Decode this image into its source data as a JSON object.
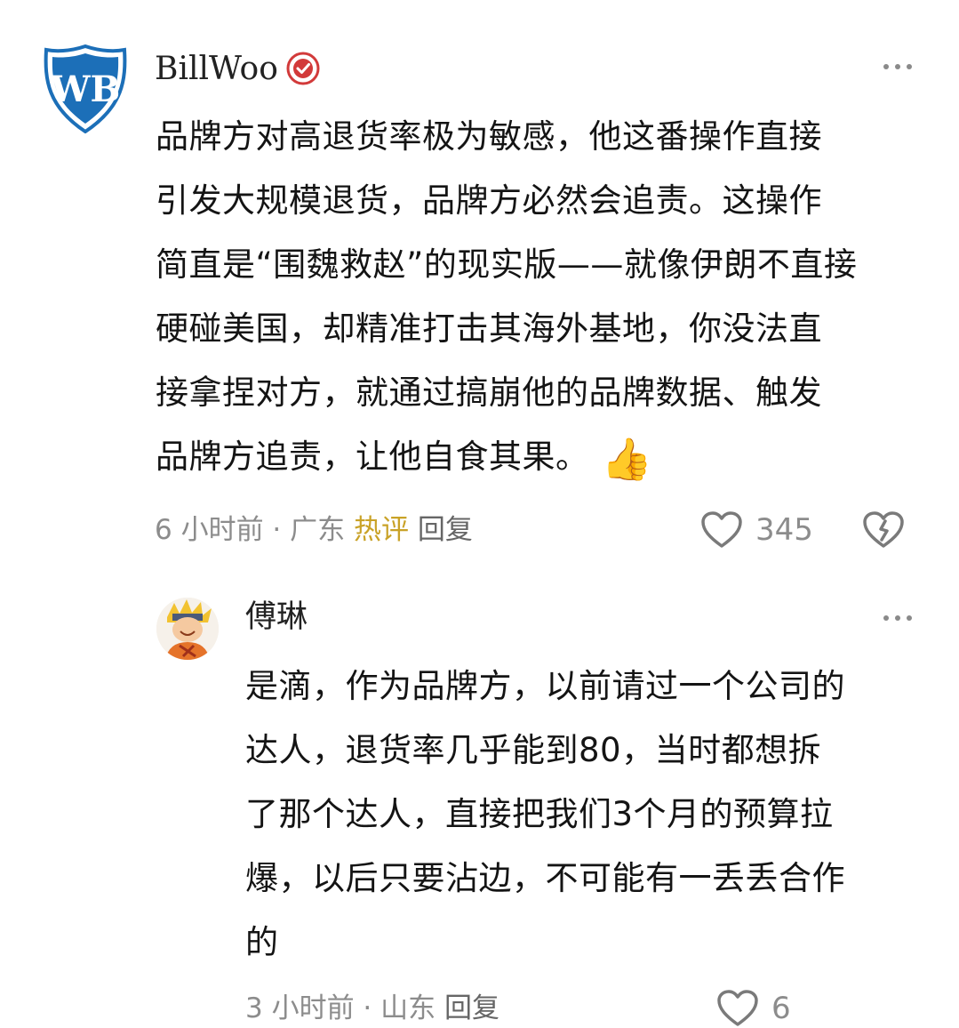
{
  "comments": [
    {
      "username": "BillWoo",
      "avatar_icon": "wb-shield-logo",
      "verified_icon": "verified-badge-icon",
      "text_lines": [
        "品牌方对高退货率极为敏感，他这番操作直接",
        "引发大规模退货，品牌方必然会追责。这操作",
        "简直是“围魏救赵”的现实版——就像伊朗不直接",
        "硬碰美国，却精准打击其海外基地，你没法直",
        "接拿捏对方，就通过搞崩他的品牌数据、触发",
        "品牌方追责，让他自食其果。"
      ],
      "emoji": "👍",
      "time": "6 小时前",
      "sep": " · ",
      "location": "广东",
      "hot_label": "热评",
      "reply_label": "回复",
      "likes": "345"
    },
    {
      "username": "傅琳",
      "avatar_icon": "cartoon-avatar",
      "text_lines": [
        "是滴，作为品牌方，以前请过一个公司的",
        "达人，退货率几乎能到80，当时都想拆",
        "了那个达人，直接把我们3个月的预算拉",
        "爆，以后只要沾边，不可能有一丢丢合作",
        "的"
      ],
      "time": "3 小时前",
      "sep": " · ",
      "location": "山东",
      "reply_label": "回复",
      "likes": "6"
    }
  ],
  "colors": {
    "wb_blue": "#1c6fb8",
    "verified_red": "#d23a3a",
    "hot_gold": "#c9a227",
    "meta_gray": "#8c8c8c"
  }
}
